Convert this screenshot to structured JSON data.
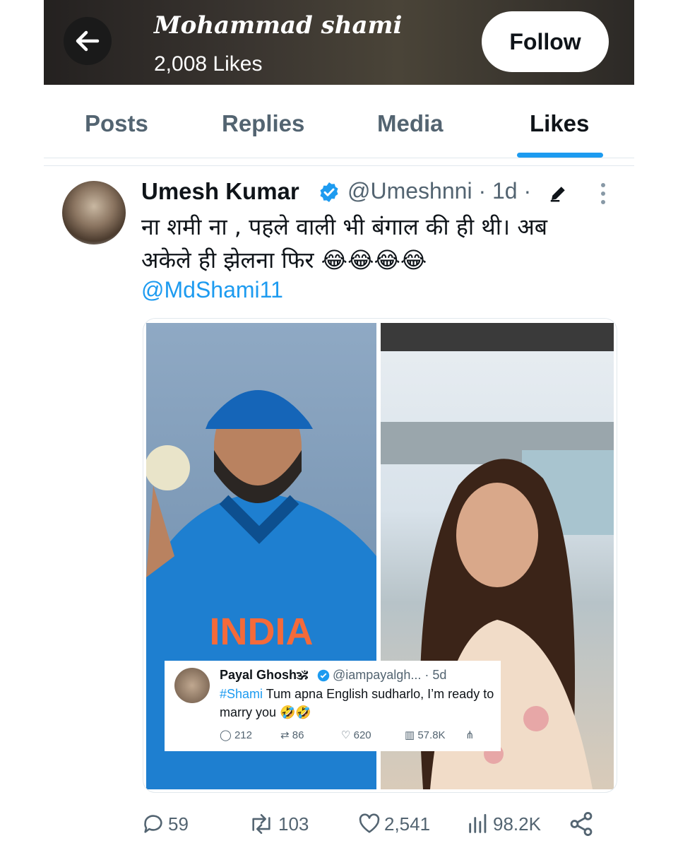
{
  "header": {
    "title": "Mohammad shami",
    "likes_count": "2,008 Likes",
    "follow_label": "Follow"
  },
  "tabs": [
    {
      "label": "Posts"
    },
    {
      "label": "Replies"
    },
    {
      "label": "Media"
    },
    {
      "label": "Likes",
      "active": true
    }
  ],
  "tweet": {
    "author_name": "Umesh Kumar",
    "author_meta": "@Umeshnni · 1d ·",
    "text_line1": "ना शमी ना , पहले वाली भी बंगाल की ही थी। अब",
    "text_line2": "अकेले ही झेलना फिर 😂😂😂😂",
    "mention": "@MdShami11",
    "stats": {
      "replies": "59",
      "reposts": "103",
      "likes": "2,541",
      "views": "98.2K"
    }
  },
  "quoted_tweet": {
    "author_name": "Payal Ghosh🕉",
    "author_meta": "@iampayalgh... · 5d",
    "hashtag": "#Shami",
    "text": " Tum apna English sudharlo, I’m ready to marry you 🤣🤣",
    "stats": {
      "replies": "212",
      "reposts": "86",
      "likes": "620",
      "views": "57.8K"
    }
  },
  "media": {
    "left_photo_text": "INDIA"
  },
  "colors": {
    "accent": "#1d9bf0",
    "text_primary": "#0f1419",
    "text_secondary": "#536471"
  }
}
